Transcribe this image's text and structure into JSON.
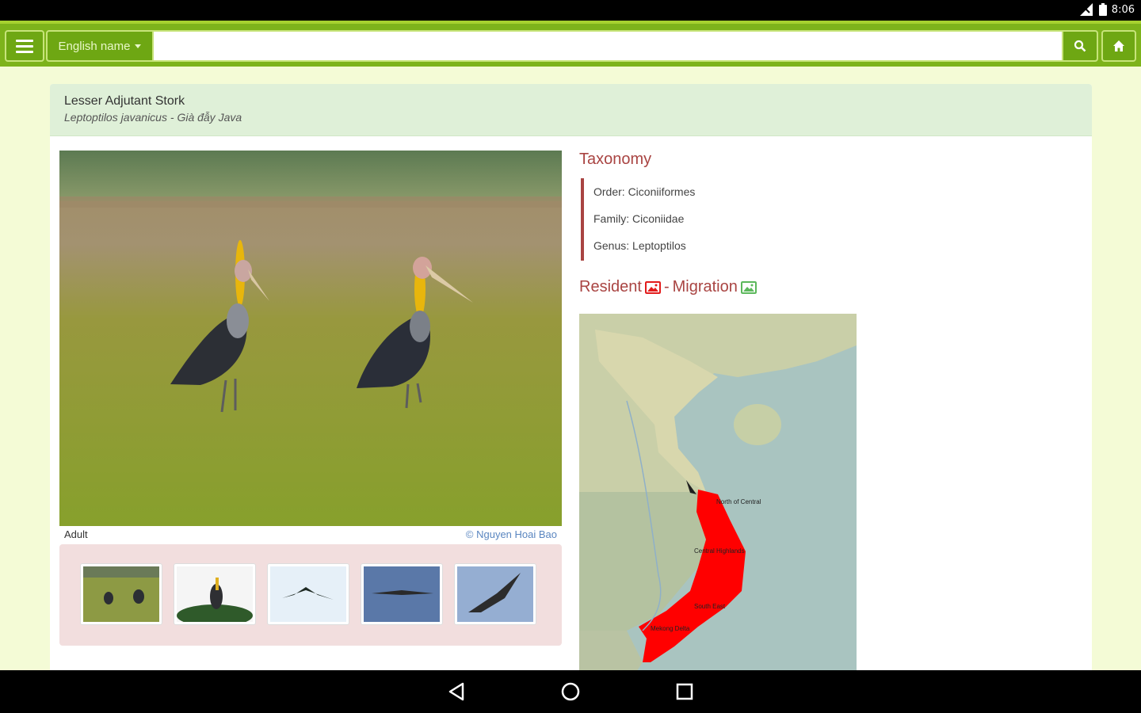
{
  "status": {
    "time": "8:06"
  },
  "toolbar": {
    "field_label": "English name",
    "search_value": "",
    "search_placeholder": ""
  },
  "species": {
    "common_name": "Lesser Adjutant Stork",
    "scientific_name": "Leptoptilos javanicus",
    "separator": " - ",
    "local_name": "Già đẫy Java"
  },
  "photo": {
    "caption": "Adult",
    "credit": "© Nguyen Hoai Bao"
  },
  "thumbnails": [
    {
      "name": "thumb-1"
    },
    {
      "name": "thumb-2"
    },
    {
      "name": "thumb-3"
    },
    {
      "name": "thumb-4"
    },
    {
      "name": "thumb-5"
    }
  ],
  "taxonomy": {
    "title": "Taxonomy",
    "order": "Order: Ciconiiformes",
    "family": "Family: Ciconiidae",
    "genus": "Genus: Leptoptilos"
  },
  "distribution": {
    "resident_label": "Resident",
    "separator": " - ",
    "migration_label": "Migration",
    "resident_color": "#ff0000",
    "migration_color": "#5cb85c",
    "map_labels": {
      "north": "North of Central",
      "highlands": "Central Highlands",
      "south": "South East",
      "mekong": "Mekong Delta"
    }
  },
  "colors": {
    "toolbar": "#7db31b",
    "header_bg": "#dff0d8",
    "accent_red": "#a94442"
  }
}
